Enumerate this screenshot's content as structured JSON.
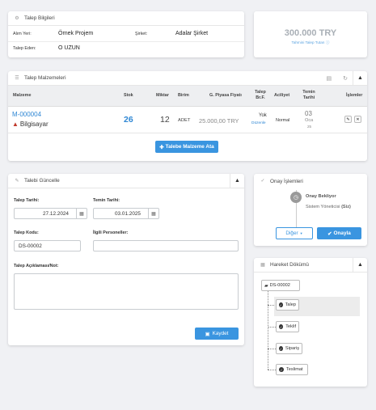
{
  "talep_bilgileri": {
    "title": "Talep Bilgileri",
    "alim_yeri_label": "Alım Yeri:",
    "alim_yeri_value": "Örnek Projem",
    "sirket_label": "Şirket:",
    "sirket_value": "Adalar Şirket",
    "talep_eden_label": "Talep Eden:",
    "talep_eden_value": "O UZUN"
  },
  "total": {
    "amount": "300.000 TRY",
    "caption": "Tahmini Talep Tutarı"
  },
  "malzemeler": {
    "title": "Talep Malzemeleri",
    "headers": {
      "malzeme": "Malzeme",
      "stok": "Stok",
      "miktar": "Miktar",
      "birim": "Birim",
      "fiyat": "G. Piyasa Fiyatı",
      "talep_brf_1": "Talep",
      "talep_brf_2": "Br.F.",
      "aciliyet": "Aciliyet",
      "temin_1": "Temin",
      "temin_2": "Tarihi",
      "islemler": "İşlemler"
    },
    "row": {
      "code": "M-000004",
      "name": "Bilgisayar",
      "stok": "26",
      "miktar": "12",
      "birim": "ADET",
      "fiyat": "25.000,00 TRY",
      "talep_brf": "Yok",
      "duzenle": "Düzenle",
      "aciliyet": "Normal",
      "temin_day": "03",
      "temin_month": "Oca",
      "temin_year": "25"
    },
    "add_button": "Talebe Malzeme Ata"
  },
  "guncelle": {
    "title": "Talebi Güncelle",
    "talep_tarihi_label": "Talep Tarihi:",
    "talep_tarihi_value": "27.12.2024",
    "temin_tarihi_label": "Temin Tarihi:",
    "temin_tarihi_value": "03.01.2025",
    "talep_kodu_label": "Talep Kodu:",
    "talep_kodu_value": "DS-00002",
    "personeller_label": "İlgili Personeller:",
    "aciklama_label": "Talep Açıklaması/Not:",
    "save_button": "Kaydet"
  },
  "onay": {
    "title": "Onay İşlemleri",
    "status": "Onay Bekliyor",
    "role": "Sistem Yöneticisi",
    "role_suffix": "(Siz)",
    "diger_button": "Diğer",
    "onayla_button": "Onayla"
  },
  "hareket": {
    "title": "Hareket Dökümü",
    "root": "DS-00002",
    "items": [
      "Talep",
      "Teklif",
      "Sipariş",
      "Teslimat"
    ]
  }
}
